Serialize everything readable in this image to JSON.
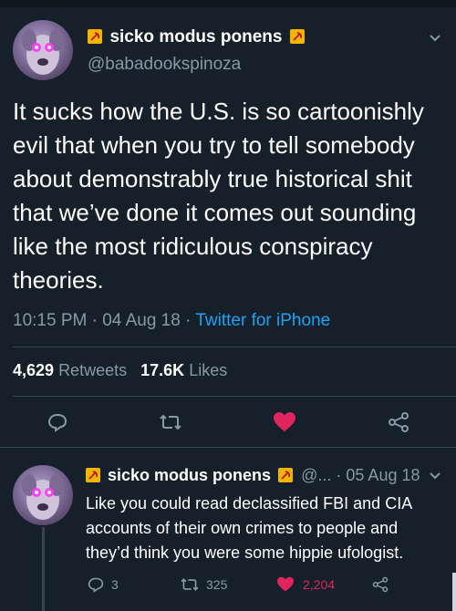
{
  "main_tweet": {
    "display_name": "sicko modus ponens",
    "handle": "@babadookspinoza",
    "text": "It sucks how the U.S. is so cartoonishly evil that when you try to tell somebody about demonstrably true historical shit that we’ve done it comes out sounding like the most ridiculous conspiracy theories.",
    "time": "10:15 PM",
    "date": "04 Aug 18",
    "source": "Twitter for iPhone",
    "retweets_count": "4,629",
    "retweets_label": "Retweets",
    "likes_count": "17.6K",
    "likes_label": "Likes",
    "liked": true
  },
  "reply_tweet": {
    "display_name": "sicko modus ponens",
    "handle_truncated": "@...",
    "date": "05 Aug 18",
    "text": "Like you could read declassified FBI and CIA accounts of their own crimes to people and they’d think you were some hippie ufologist.",
    "reply_count": "3",
    "retweet_count": "325",
    "like_count": "2,204",
    "liked": true
  },
  "colors": {
    "background": "#15202b",
    "text": "#ffffff",
    "muted": "#8899a6",
    "link": "#1da1f2",
    "like": "#e0245e",
    "divider": "#38444d",
    "flag": "#f5b400"
  },
  "icons": {
    "dropdown": "chevron-down-icon",
    "reply": "reply-icon",
    "retweet": "retweet-icon",
    "like": "heart-icon",
    "share": "share-icon",
    "badge": "hammer-sickle-icon"
  }
}
